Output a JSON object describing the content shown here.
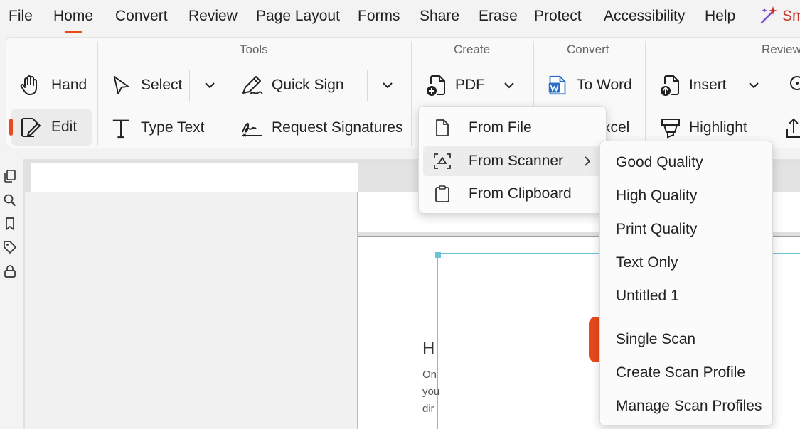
{
  "menubar": {
    "items": [
      "File",
      "Home",
      "Convert",
      "Review",
      "Page Layout",
      "Forms",
      "Share",
      "Erase",
      "Protect",
      "Accessibility",
      "Help"
    ],
    "active": "Home",
    "smart_label": "Sm"
  },
  "ribbon": {
    "groups": {
      "tools": "Tools",
      "create": "Create",
      "convert": "Convert",
      "review": "Review"
    },
    "hand": "Hand",
    "edit": "Edit",
    "select": "Select",
    "type_text": "Type Text",
    "quick_sign": "Quick Sign",
    "request_signatures": "Request Signatures",
    "pdf": "PDF",
    "to_word": "To Word",
    "to_excel_partial": "xcel",
    "insert": "Insert",
    "highlight": "Highlight"
  },
  "pdf_menu": {
    "items": [
      {
        "label": "From File",
        "icon": "file-icon"
      },
      {
        "label": "From Scanner",
        "icon": "scanner-icon",
        "highlighted": true,
        "has_submenu": true
      },
      {
        "label": "From Clipboard",
        "icon": "clipboard-icon"
      }
    ]
  },
  "scanner_submenu": {
    "presets": [
      "Good Quality",
      "High Quality",
      "Print Quality",
      "Text Only",
      "Untitled 1"
    ],
    "actions": [
      "Single Scan",
      "Create Scan Profile",
      "Manage Scan Profiles"
    ]
  },
  "document": {
    "heading_partial": "H",
    "line1_partial": "On",
    "line2_partial": "you",
    "line3_partial": "dir"
  },
  "colors": {
    "accent": "#e8491d",
    "selection": "#6fc3d8",
    "word_blue": "#2b6cc4"
  }
}
